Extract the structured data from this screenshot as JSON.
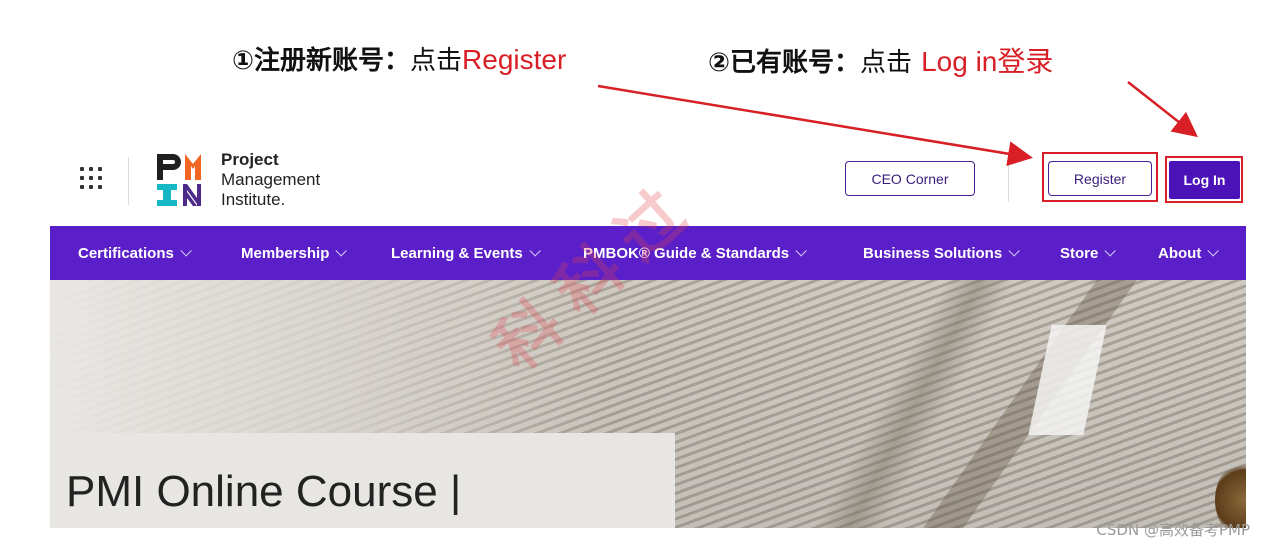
{
  "annotation": {
    "step1_prefix": "①注册新账号：",
    "step1_action": "点击",
    "step1_target": "Register",
    "step2_prefix": "②已有账号：",
    "step2_action": "点击",
    "step2_target": "Log in登录"
  },
  "header": {
    "menu_icon": "grid-menu-icon",
    "logo": {
      "line1": "Project",
      "line2": "Management",
      "line3": "Institute."
    },
    "ceo_corner_label": "CEO Corner",
    "register_label": "Register",
    "login_label": "Log In"
  },
  "nav": {
    "items": [
      {
        "label": "Certifications"
      },
      {
        "label": "Membership"
      },
      {
        "label": "Learning & Events"
      },
      {
        "label": "PMBOK® Guide & Standards"
      },
      {
        "label": "Business Solutions"
      },
      {
        "label": "Store"
      },
      {
        "label": "About"
      }
    ]
  },
  "hero": {
    "title": "PMI Online Course |"
  },
  "watermark": "科科过",
  "credit": "CSDN @高效备考PMP",
  "colors": {
    "brand_purple": "#5b1fc9",
    "highlight_red": "#d81f26",
    "logo_teal": "#17b8c6",
    "logo_orange": "#f26522"
  }
}
